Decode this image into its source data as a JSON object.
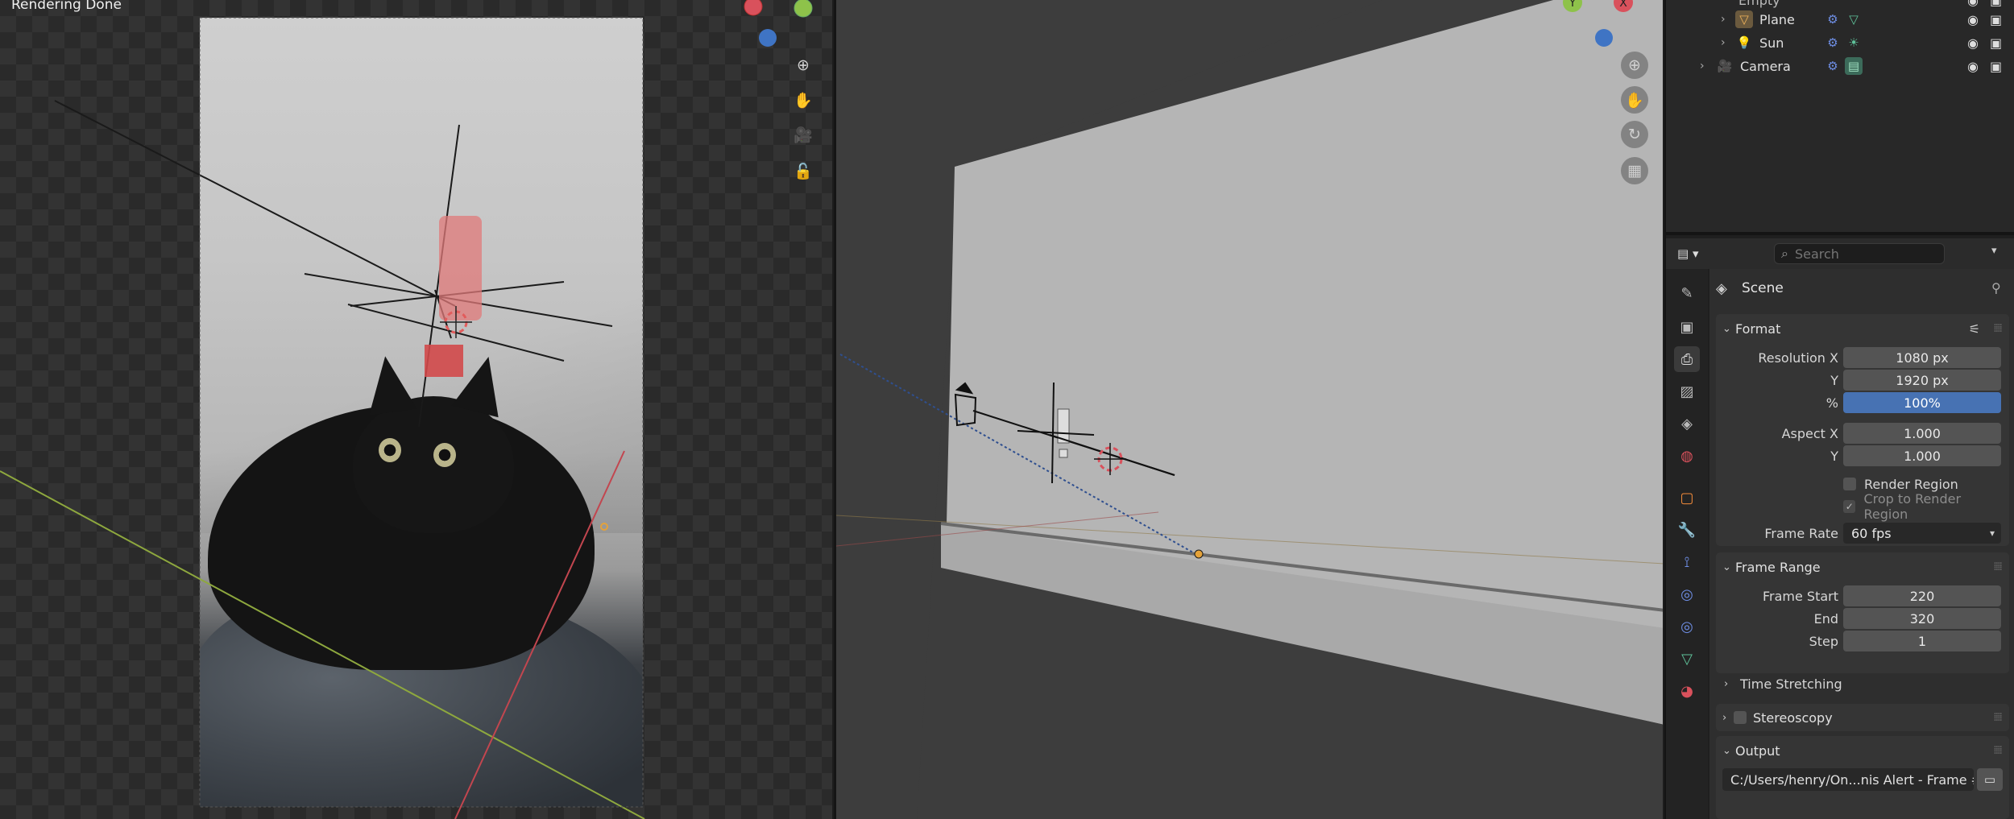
{
  "render_view": {
    "status": "Rendering Done",
    "nav_icons": [
      "zoom-icon",
      "hand-pan-icon",
      "camera-view-icon",
      "lock-icon"
    ]
  },
  "viewport3d": {
    "nav_icons": [
      "zoom-icon",
      "hand-pan-icon",
      "orbit-icon",
      "grid-icon"
    ]
  },
  "gizmo": {
    "y_label": "Y",
    "x_label": "X"
  },
  "outliner": {
    "items": [
      {
        "label": "Empty",
        "icon": "empty-icon",
        "indent": 2
      },
      {
        "label": "Plane",
        "icon": "mesh-object-icon",
        "indent": 2
      },
      {
        "label": "Sun",
        "icon": "light-icon",
        "indent": 2
      },
      {
        "label": "Camera",
        "icon": "camera-object-icon",
        "indent": 1
      }
    ]
  },
  "properties": {
    "search_placeholder": "Search",
    "context_name": "Scene",
    "format": {
      "title": "Format",
      "resolution_x_label": "Resolution X",
      "resolution_x": "1080 px",
      "resolution_y_label": "Y",
      "resolution_y": "1920 px",
      "percent_label": "%",
      "percent": "100%",
      "aspect_x_label": "Aspect X",
      "aspect_x": "1.000",
      "aspect_y_label": "Y",
      "aspect_y": "1.000",
      "render_region": "Render Region",
      "crop_region": "Crop to Render Region",
      "frame_rate_label": "Frame Rate",
      "frame_rate": "60 fps"
    },
    "frame_range": {
      "title": "Frame Range",
      "start_label": "Frame Start",
      "start": "220",
      "end_label": "End",
      "end": "320",
      "step_label": "Step",
      "step": "1",
      "time_stretching": "Time Stretching"
    },
    "stereoscopy": {
      "title": "Stereoscopy"
    },
    "output": {
      "title": "Output",
      "path": "C:/Users/henry/On...nis Alert - Frame #"
    }
  },
  "colors": {
    "accent_blue": "#4772b3",
    "x_axis": "#d9515c",
    "y_axis": "#8ec24a",
    "z_axis": "#3f74c4"
  }
}
